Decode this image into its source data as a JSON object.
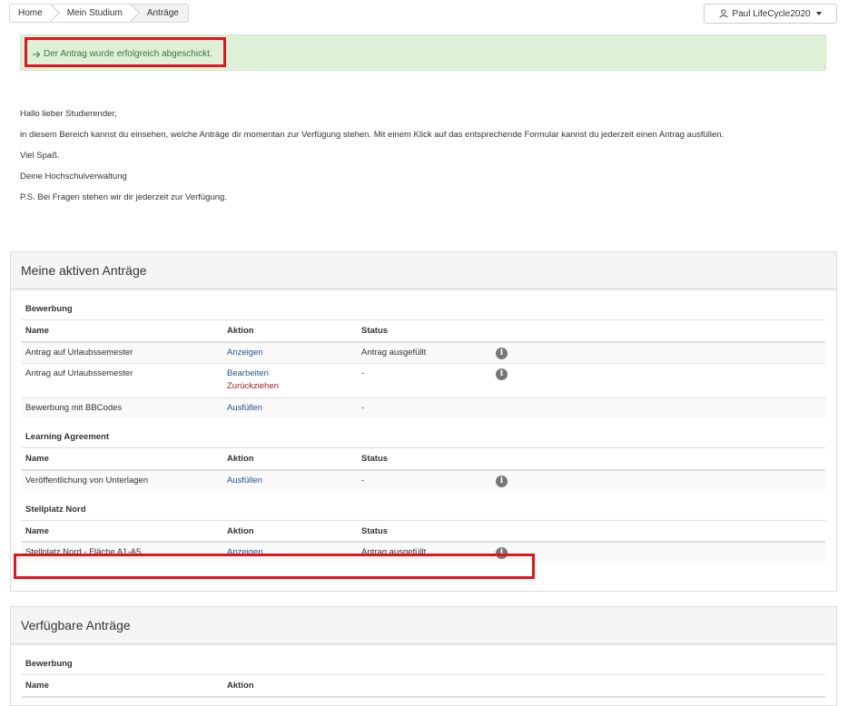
{
  "breadcrumb": [
    "Home",
    "Mein Studium",
    "Anträge"
  ],
  "user": {
    "name": "Paul LifeCycle2020",
    "icon": "user-icon"
  },
  "alert": {
    "text": "Der Antrag wurde erfolgreich abgeschickt.",
    "icon": "arrow-right-icon",
    "color": "#3c763d"
  },
  "intro": [
    "Hallo lieber Studierender,",
    "in diesem Bereich kannst du einsehen, welche Anträge dir momentan zur Verfügung stehen. Mit einem Klick auf das entsprechende Formular kannst du jederzeit einen Antrag ausfüllen.",
    "Viel Spaß.",
    "Deine Hochschulverwaltung",
    "P.S. Bei Fragen stehen wir dir jederzeit zur Verfügung."
  ],
  "active_panel": {
    "title": "Meine aktiven Anträge",
    "headers": {
      "name": "Name",
      "aktion": "Aktion",
      "status": "Status"
    },
    "groups": [
      {
        "title": "Bewerbung",
        "rows": [
          {
            "name": "Antrag auf Urlaubssemester",
            "actions": [
              "Anzeigen"
            ],
            "status": "Antrag ausgefüllt",
            "info": true
          },
          {
            "name": "Antrag auf Urlaubssemester",
            "actions": [
              "Bearbeiten"
            ],
            "danger_action": "Zurückziehen",
            "status": "-",
            "info": true
          },
          {
            "name": "Bewerbung mit BBCodes",
            "actions": [
              "Ausfüllen"
            ],
            "status": "-",
            "info": false
          }
        ]
      },
      {
        "title": "Learning Agreement",
        "rows": [
          {
            "name": "Veröffentlichung von Unterlagen",
            "actions": [
              "Ausfüllen"
            ],
            "status": "-",
            "info": true
          }
        ]
      },
      {
        "title": "Stellplatz Nord",
        "rows": [
          {
            "name": "Stellplatz Nord - Fläche A1-A5",
            "actions": [
              "Anzeigen"
            ],
            "status": "Antrag ausgefüllt",
            "info": true
          }
        ]
      }
    ]
  },
  "available_panel": {
    "title": "Verfügbare Anträge",
    "headers": {
      "name": "Name",
      "aktion": "Aktion"
    },
    "groups": [
      {
        "title": "Bewerbung"
      }
    ]
  },
  "colors": {
    "link": "#22558c",
    "danger": "#a01f1f",
    "highlight": "#e0161f",
    "alert_bg": "#dff0d8"
  }
}
